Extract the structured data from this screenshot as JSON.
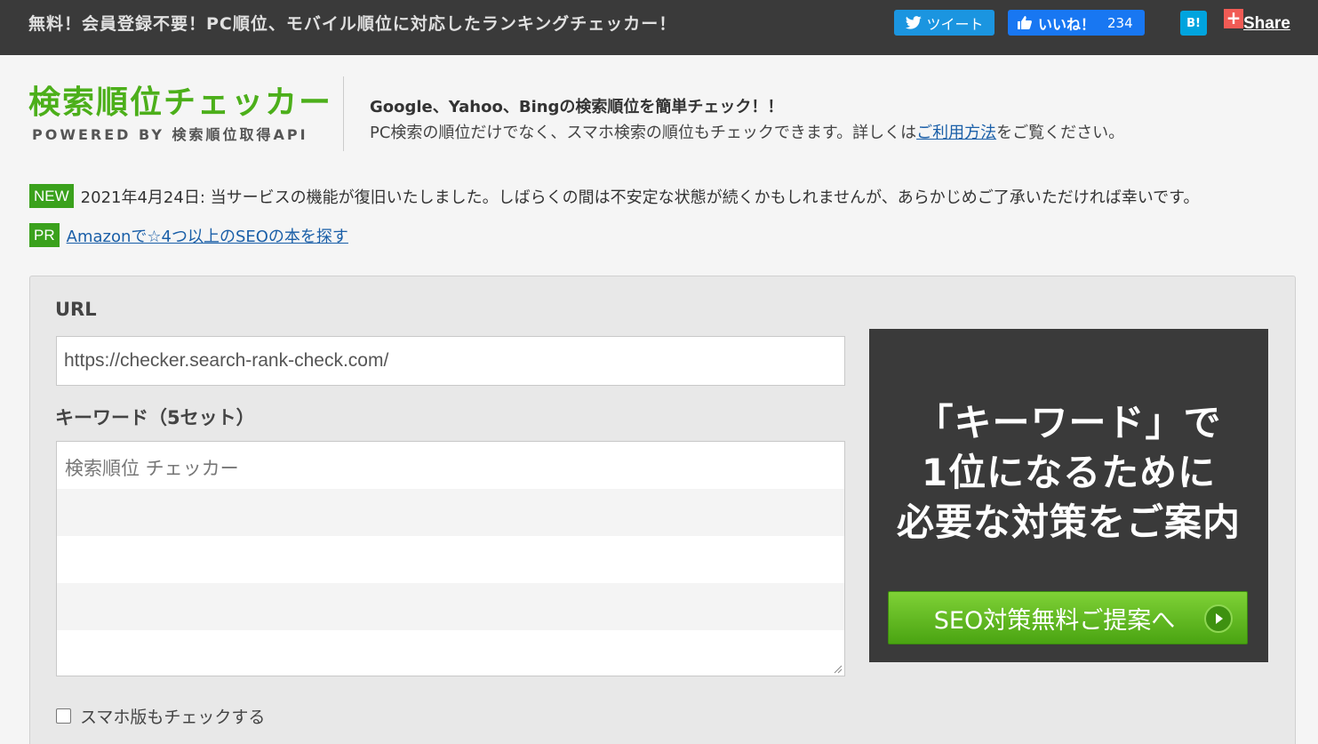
{
  "topbar": {
    "tagline": "無料！会員登録不要！PC順位、モバイル順位に対応したランキングチェッカー！",
    "tweet_label": "ツイート",
    "like_label": "いいね！",
    "like_count": "234",
    "hatena_label": "B!",
    "share_label": "Share"
  },
  "header": {
    "logo_title": "検索順位チェッカー",
    "logo_subtitle": "POWERED BY 検索順位取得API",
    "intro_heading": "Google、Yahoo、Bingの検索順位を簡単チェック！！",
    "intro_text_before": "PC検索の順位だけでなく、スマホ検索の順位もチェックできます。詳しくは",
    "intro_link": "ご利用方法",
    "intro_text_after": "をご覧ください。"
  },
  "notices": [
    {
      "badge": "NEW",
      "text": "2021年4月24日: 当サービスの機能が復旧いたしました。しばらくの間は不安定な状態が続くかもしれませんが、あらかじめご了承いただければ幸いです。"
    },
    {
      "badge": "PR",
      "link": "Amazonで☆4つ以上のSEOの本を探す"
    }
  ],
  "form": {
    "url_label": "URL",
    "url_value": "https://checker.search-rank-check.com/",
    "keyword_label": "キーワード（5セット）",
    "keyword_placeholder": "検索順位 チェッカー",
    "mobile_check_label": "スマホ版もチェックする",
    "mobile_checked": false
  },
  "ad": {
    "lines": [
      "「キーワード」で",
      "1位になるために",
      "必要な対策をご案内"
    ],
    "cta_label": "SEO対策無料ご提案へ"
  },
  "colors": {
    "topbar": "#3a3a3a",
    "brand_green": "#4caf1a",
    "twitter": "#1b95e0",
    "facebook": "#1877f2",
    "hatena": "#00a4de",
    "link": "#1a5fa8"
  }
}
